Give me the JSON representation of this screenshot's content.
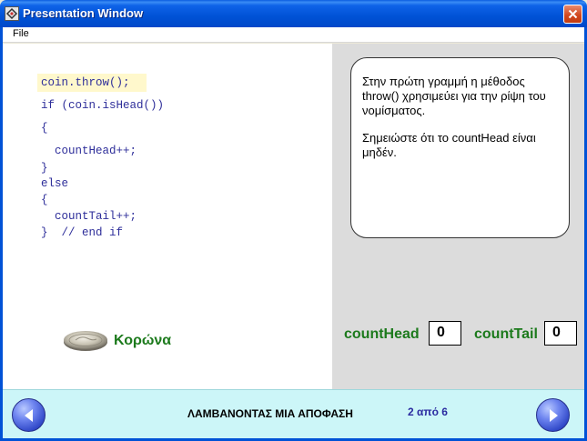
{
  "window": {
    "title": "Presentation Window"
  },
  "menu": {
    "file_label": "File"
  },
  "code": {
    "lines": [
      "coin.throw();",
      "if (coin.isHead())",
      "{",
      "  countHead++;",
      "}",
      "else",
      "{",
      "  countTail++;",
      "}  // end if"
    ],
    "highlighted_line": 0
  },
  "coin": {
    "label": "Κορώνα"
  },
  "explanation": {
    "paragraph1": "Στην πρώτη γραμμή η μέθοδος throw() χρησιμεύει για την ρίψη του νομίσματος.",
    "paragraph2": "Σημειώστε ότι το countHead είναι μηδέν."
  },
  "counters": {
    "head_label": "countHead",
    "head_value": "0",
    "tail_label": "countTail",
    "tail_value": "0"
  },
  "nav": {
    "title": "ΛΑΜΒΑΝΟΝΤΑΣ ΜΙΑ ΑΠΟΦΑΣΗ",
    "page": "2 από 6"
  },
  "colors": {
    "titlebar": "#0052d6",
    "code_text": "#2e2e9a",
    "highlight": "#fff8cc",
    "green_label": "#1c7a1c",
    "nav_bg": "#ccf6f8",
    "nav_button": "#3048c8"
  }
}
